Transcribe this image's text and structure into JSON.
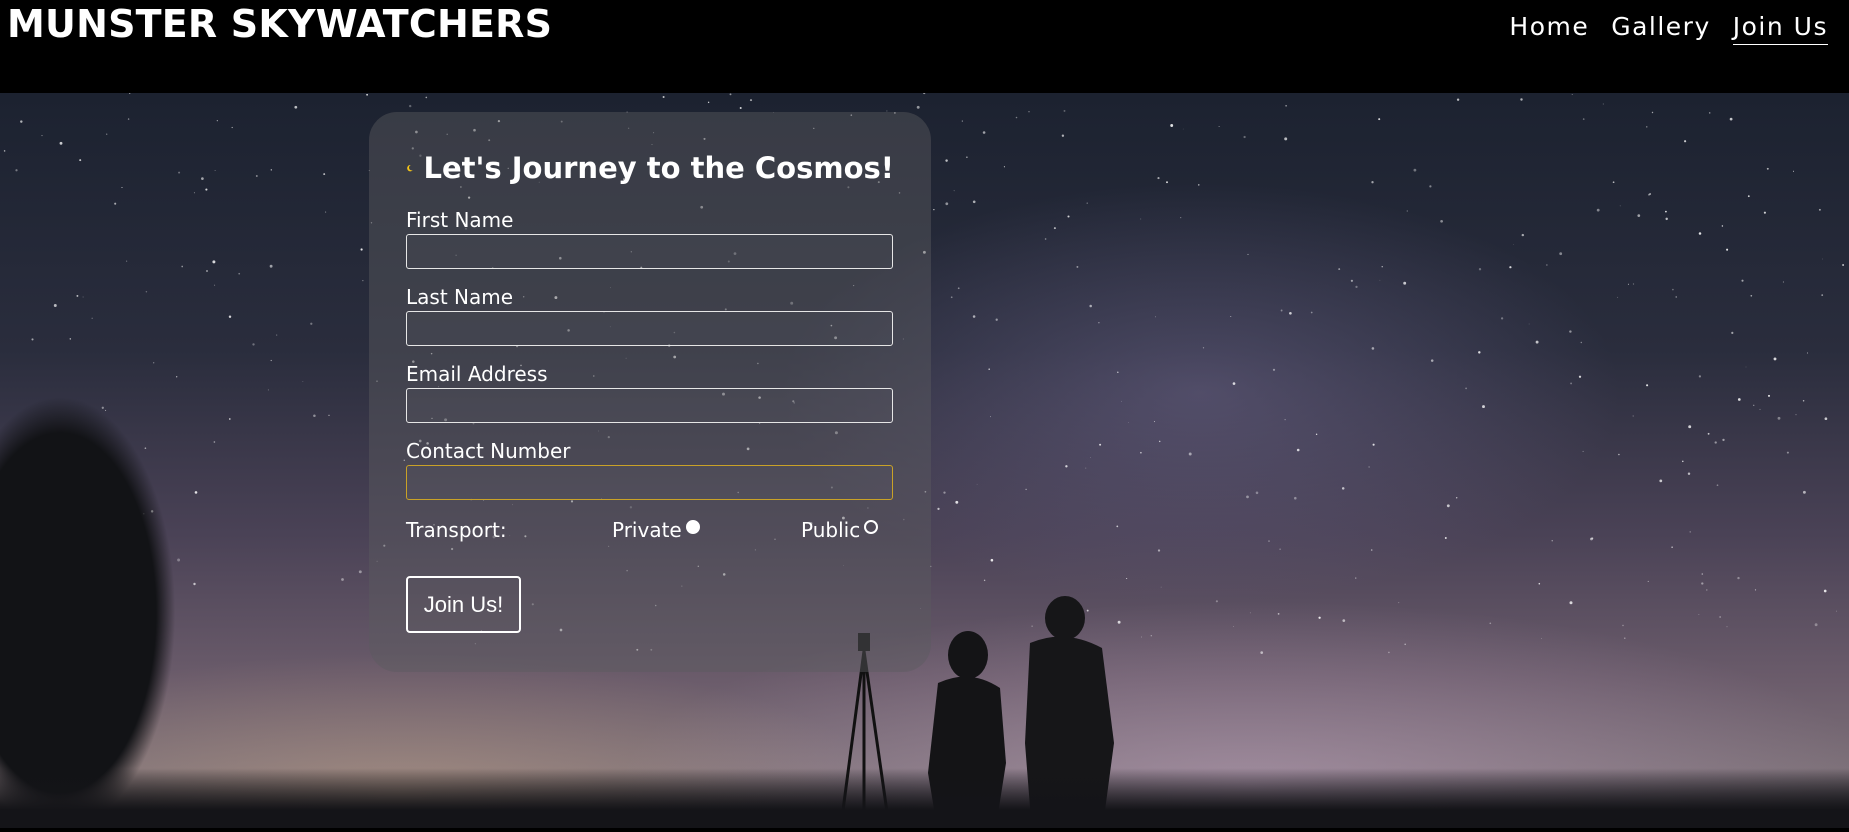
{
  "header": {
    "brand": "MUNSTER SKYWATCHERS",
    "nav": [
      {
        "label": "Home",
        "active": false
      },
      {
        "label": "Gallery",
        "active": false
      },
      {
        "label": "Join Us",
        "active": true
      }
    ]
  },
  "form": {
    "title": "Let's Journey to the Cosmos!",
    "title_icon": "moon-icon",
    "fields": {
      "first_name": {
        "label": "First Name",
        "value": ""
      },
      "last_name": {
        "label": "Last Name",
        "value": ""
      },
      "email": {
        "label": "Email Address",
        "value": ""
      },
      "contact": {
        "label": "Contact Number",
        "value": ""
      }
    },
    "transport": {
      "label": "Transport:",
      "private": "Private",
      "public": "Public",
      "selected": "Private"
    },
    "submit": "Join Us!"
  },
  "colors": {
    "accent_moon": "#f5c518",
    "focus_border": "#c9a227",
    "header_bg": "#000000"
  }
}
